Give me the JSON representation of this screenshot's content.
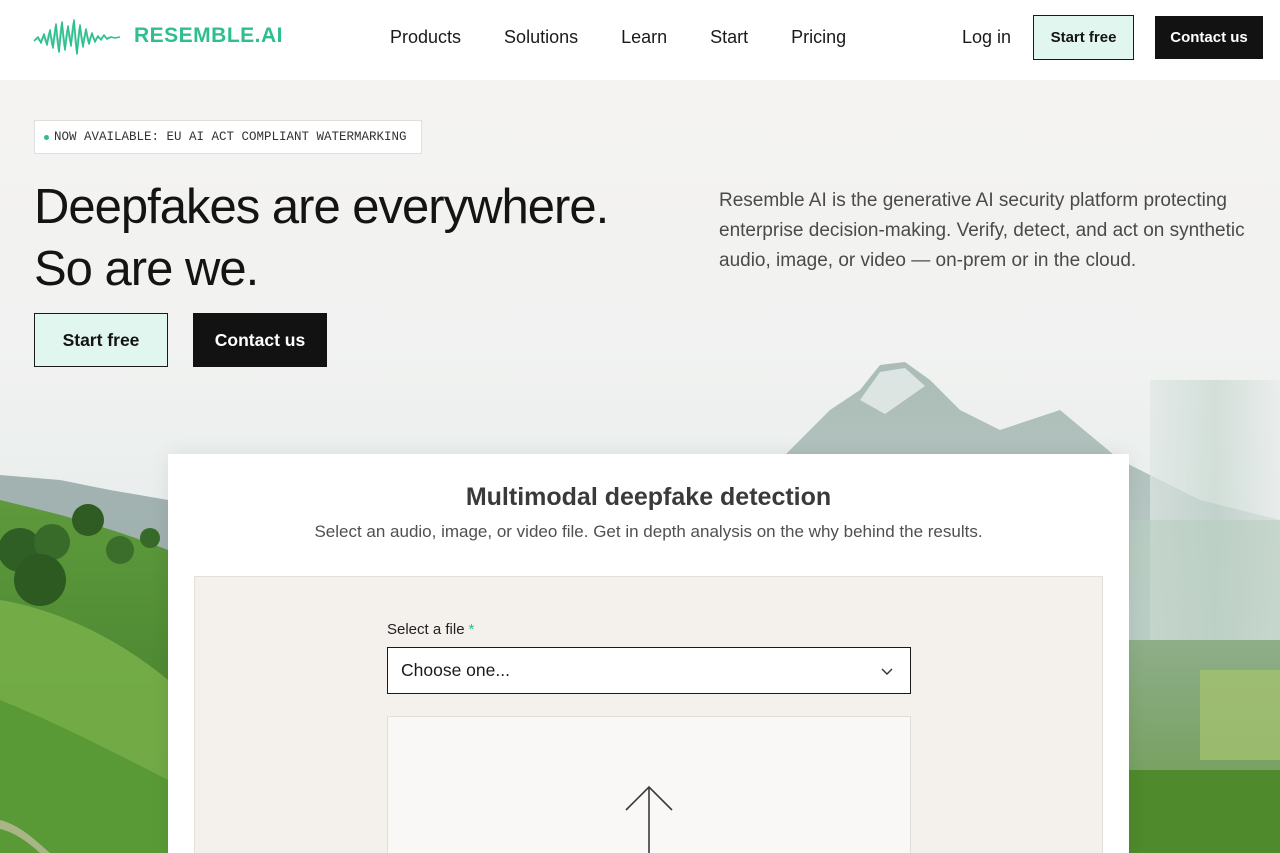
{
  "brand": {
    "name": "RESEMBLE.AI",
    "accent": "#2fbf8f",
    "dark": "#121212",
    "mint": "#e0f6ef"
  },
  "nav": {
    "items": [
      "Products",
      "Solutions",
      "Learn",
      "Start",
      "Pricing"
    ],
    "login": "Log in",
    "start_free": "Start free",
    "contact": "Contact us"
  },
  "hero": {
    "badge": "NOW AVAILABLE: EU AI ACT COMPLIANT WATERMARKING",
    "headline_line1": "Deepfakes are everywhere.",
    "headline_line2": "So are we.",
    "intro": "Resemble AI is the generative AI security platform protecting enterprise decision-making. Verify, detect, and act on synthetic audio, image, or video — on-prem or in the cloud.",
    "start_free": "Start free",
    "contact": "Contact us"
  },
  "detector": {
    "title": "Multimodal deepfake detection",
    "subtitle": "Select an audio, image, or video file. Get in depth analysis on the why behind the results.",
    "field_label": "Select a file",
    "required_mark": "*",
    "select_value": "Choose one...",
    "icons": {
      "select": "chevron-down-icon",
      "dropzone": "upload-arrow-icon"
    }
  }
}
